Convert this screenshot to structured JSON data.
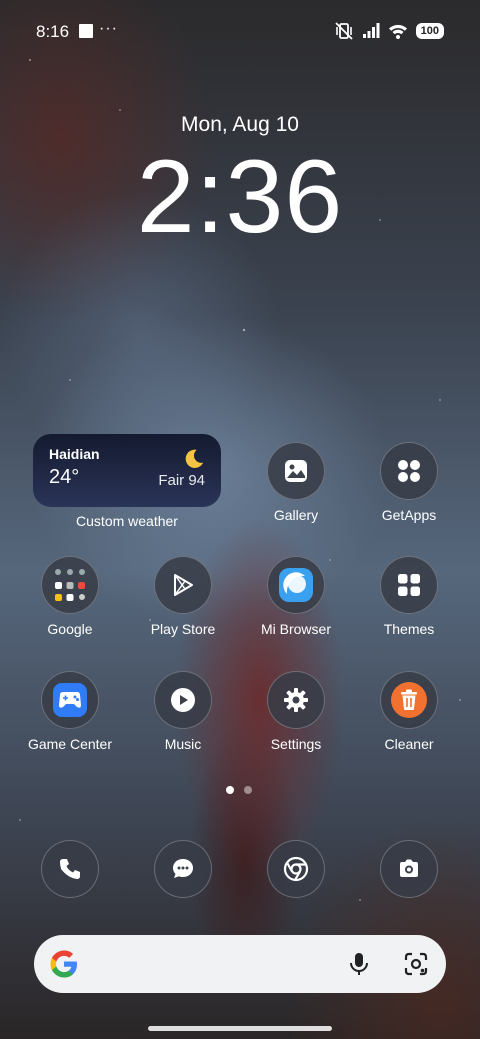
{
  "status_bar": {
    "time": "8:16",
    "more": "···",
    "battery": "100",
    "icons": [
      "notification-square-icon",
      "vibrate-off-icon",
      "signal-icon",
      "wifi-icon",
      "battery-icon"
    ]
  },
  "lockclock": {
    "date": "Mon, Aug 10",
    "time": "2:36"
  },
  "weather_widget": {
    "city": "Haidian",
    "temperature": "24°",
    "condition": "Fair 94",
    "icon": "moon-icon",
    "label": "Custom weather"
  },
  "apps": {
    "gallery": "Gallery",
    "getapps": "GetApps",
    "google": "Google",
    "play_store": "Play Store",
    "mi_browser": "Mi Browser",
    "themes": "Themes",
    "game_center": "Game Center",
    "music": "Music",
    "settings": "Settings",
    "cleaner": "Cleaner"
  },
  "dock": [
    "phone-icon",
    "messaging-icon",
    "chrome-icon",
    "camera-icon"
  ],
  "page_indicator": {
    "pages": 2,
    "current": 1
  },
  "search_bar": {
    "icons": [
      "google-g-icon",
      "microphone-icon",
      "lens-icon"
    ]
  },
  "colors": {
    "weather_bg": "#1e2541",
    "cleaner_accent": "#f07130",
    "browser_accent": "#3aa0f0",
    "game_center_accent": "#2f7cf6"
  }
}
